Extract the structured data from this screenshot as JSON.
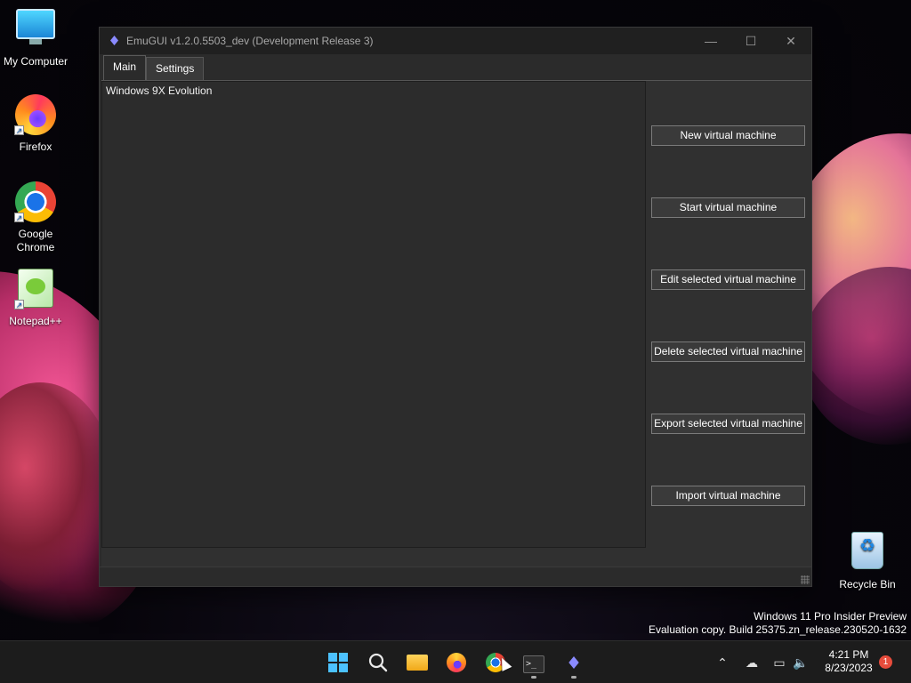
{
  "desktop": {
    "icons": [
      {
        "label": "My Computer",
        "icon": "monitor-icon"
      },
      {
        "label": "Firefox",
        "icon": "firefox-icon"
      },
      {
        "label": "Google Chrome",
        "icon": "chrome-icon"
      },
      {
        "label": "Notepad++",
        "icon": "notepadpp-icon"
      },
      {
        "label": "Recycle Bin",
        "icon": "recycle-bin-icon"
      }
    ],
    "watermark": {
      "line1": "Windows 11 Pro Insider Preview",
      "line2": "Evaluation copy. Build 25375.zn_release.230520-1632"
    }
  },
  "window": {
    "title": "EmuGUI v1.2.0.5503_dev (Development Release 3)",
    "controls": {
      "minimize": "—",
      "maximize": "☐",
      "close": "✕"
    },
    "tabs": [
      {
        "label": "Main",
        "active": true
      },
      {
        "label": "Settings",
        "active": false
      }
    ],
    "vm_list": [
      "Windows 9X Evolution"
    ],
    "buttons": {
      "new_vm": "New virtual machine",
      "start_vm": "Start virtual machine",
      "edit_vm": "Edit selected virtual machine",
      "delete_vm": "Delete selected virtual machine",
      "export_vm": "Export selected virtual machine",
      "import_vm": "Import virtual machine"
    }
  },
  "taskbar": {
    "apps": [
      "start-icon",
      "search-icon",
      "file-explorer-icon",
      "firefox-icon",
      "chrome-icon",
      "terminal-icon",
      "emugui-icon"
    ],
    "terminal_glyph": ">_",
    "tray": {
      "chevron": "⌃",
      "cloud": "☁",
      "network": "▭",
      "volume": "🔈"
    },
    "time": "4:21 PM",
    "date": "8/23/2023",
    "notification_count": "1"
  },
  "colors": {
    "window_bg": "#2b2b2b",
    "titlebar_bg": "#202020",
    "taskbar_bg": "#1c1c1c",
    "accent": "#4cc2ff",
    "notification_badge": "#e74c3c"
  }
}
